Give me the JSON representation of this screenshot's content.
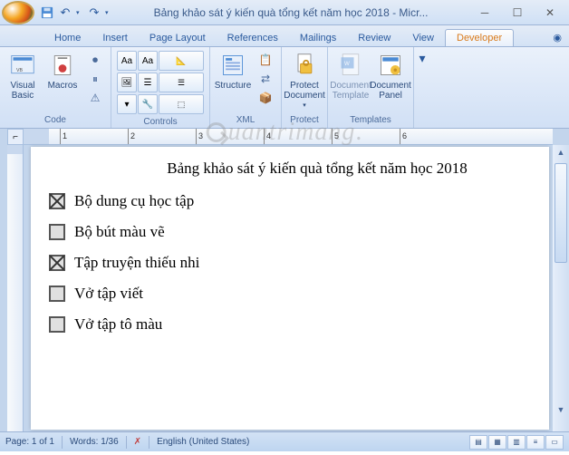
{
  "titlebar": {
    "title": "Bảng khảo sát ý kiến quà tổng kết năm học 2018 - Micr..."
  },
  "tabs": {
    "items": [
      "Home",
      "Insert",
      "Page Layout",
      "References",
      "Mailings",
      "Review",
      "View",
      "Developer"
    ],
    "active_index": 7
  },
  "ribbon": {
    "groups": {
      "code": {
        "label": "Code",
        "visual_basic": "Visual\nBasic",
        "macros": "Macros"
      },
      "controls": {
        "label": "Controls"
      },
      "xml": {
        "label": "XML",
        "structure": "Structure"
      },
      "protect": {
        "label": "Protect",
        "protect_doc": "Protect\nDocument"
      },
      "templates": {
        "label": "Templates",
        "doc_template": "Document\nTemplate",
        "doc_panel": "Document\nPanel"
      }
    }
  },
  "ruler": {
    "numbers": [
      "1",
      "2",
      "3",
      "4",
      "5",
      "6"
    ]
  },
  "document": {
    "heading": "Bảng khảo sát ý kiến quà tổng kết năm học 2018",
    "items": [
      {
        "label": "Bộ dung cụ học tập",
        "checked": true
      },
      {
        "label": "Bộ bút màu vẽ",
        "checked": false
      },
      {
        "label": "Tập truyện thiếu nhi",
        "checked": true
      },
      {
        "label": "Vở tập viết",
        "checked": false
      },
      {
        "label": "Vở tập tô màu",
        "checked": false
      }
    ]
  },
  "statusbar": {
    "page": "Page: 1 of 1",
    "words": "Words: 1/36",
    "language": "English (United States)"
  },
  "watermark": "uantrimang",
  "colors": {
    "ribbon_bg": "#d3e2f5",
    "accent": "#2a5a9e"
  }
}
